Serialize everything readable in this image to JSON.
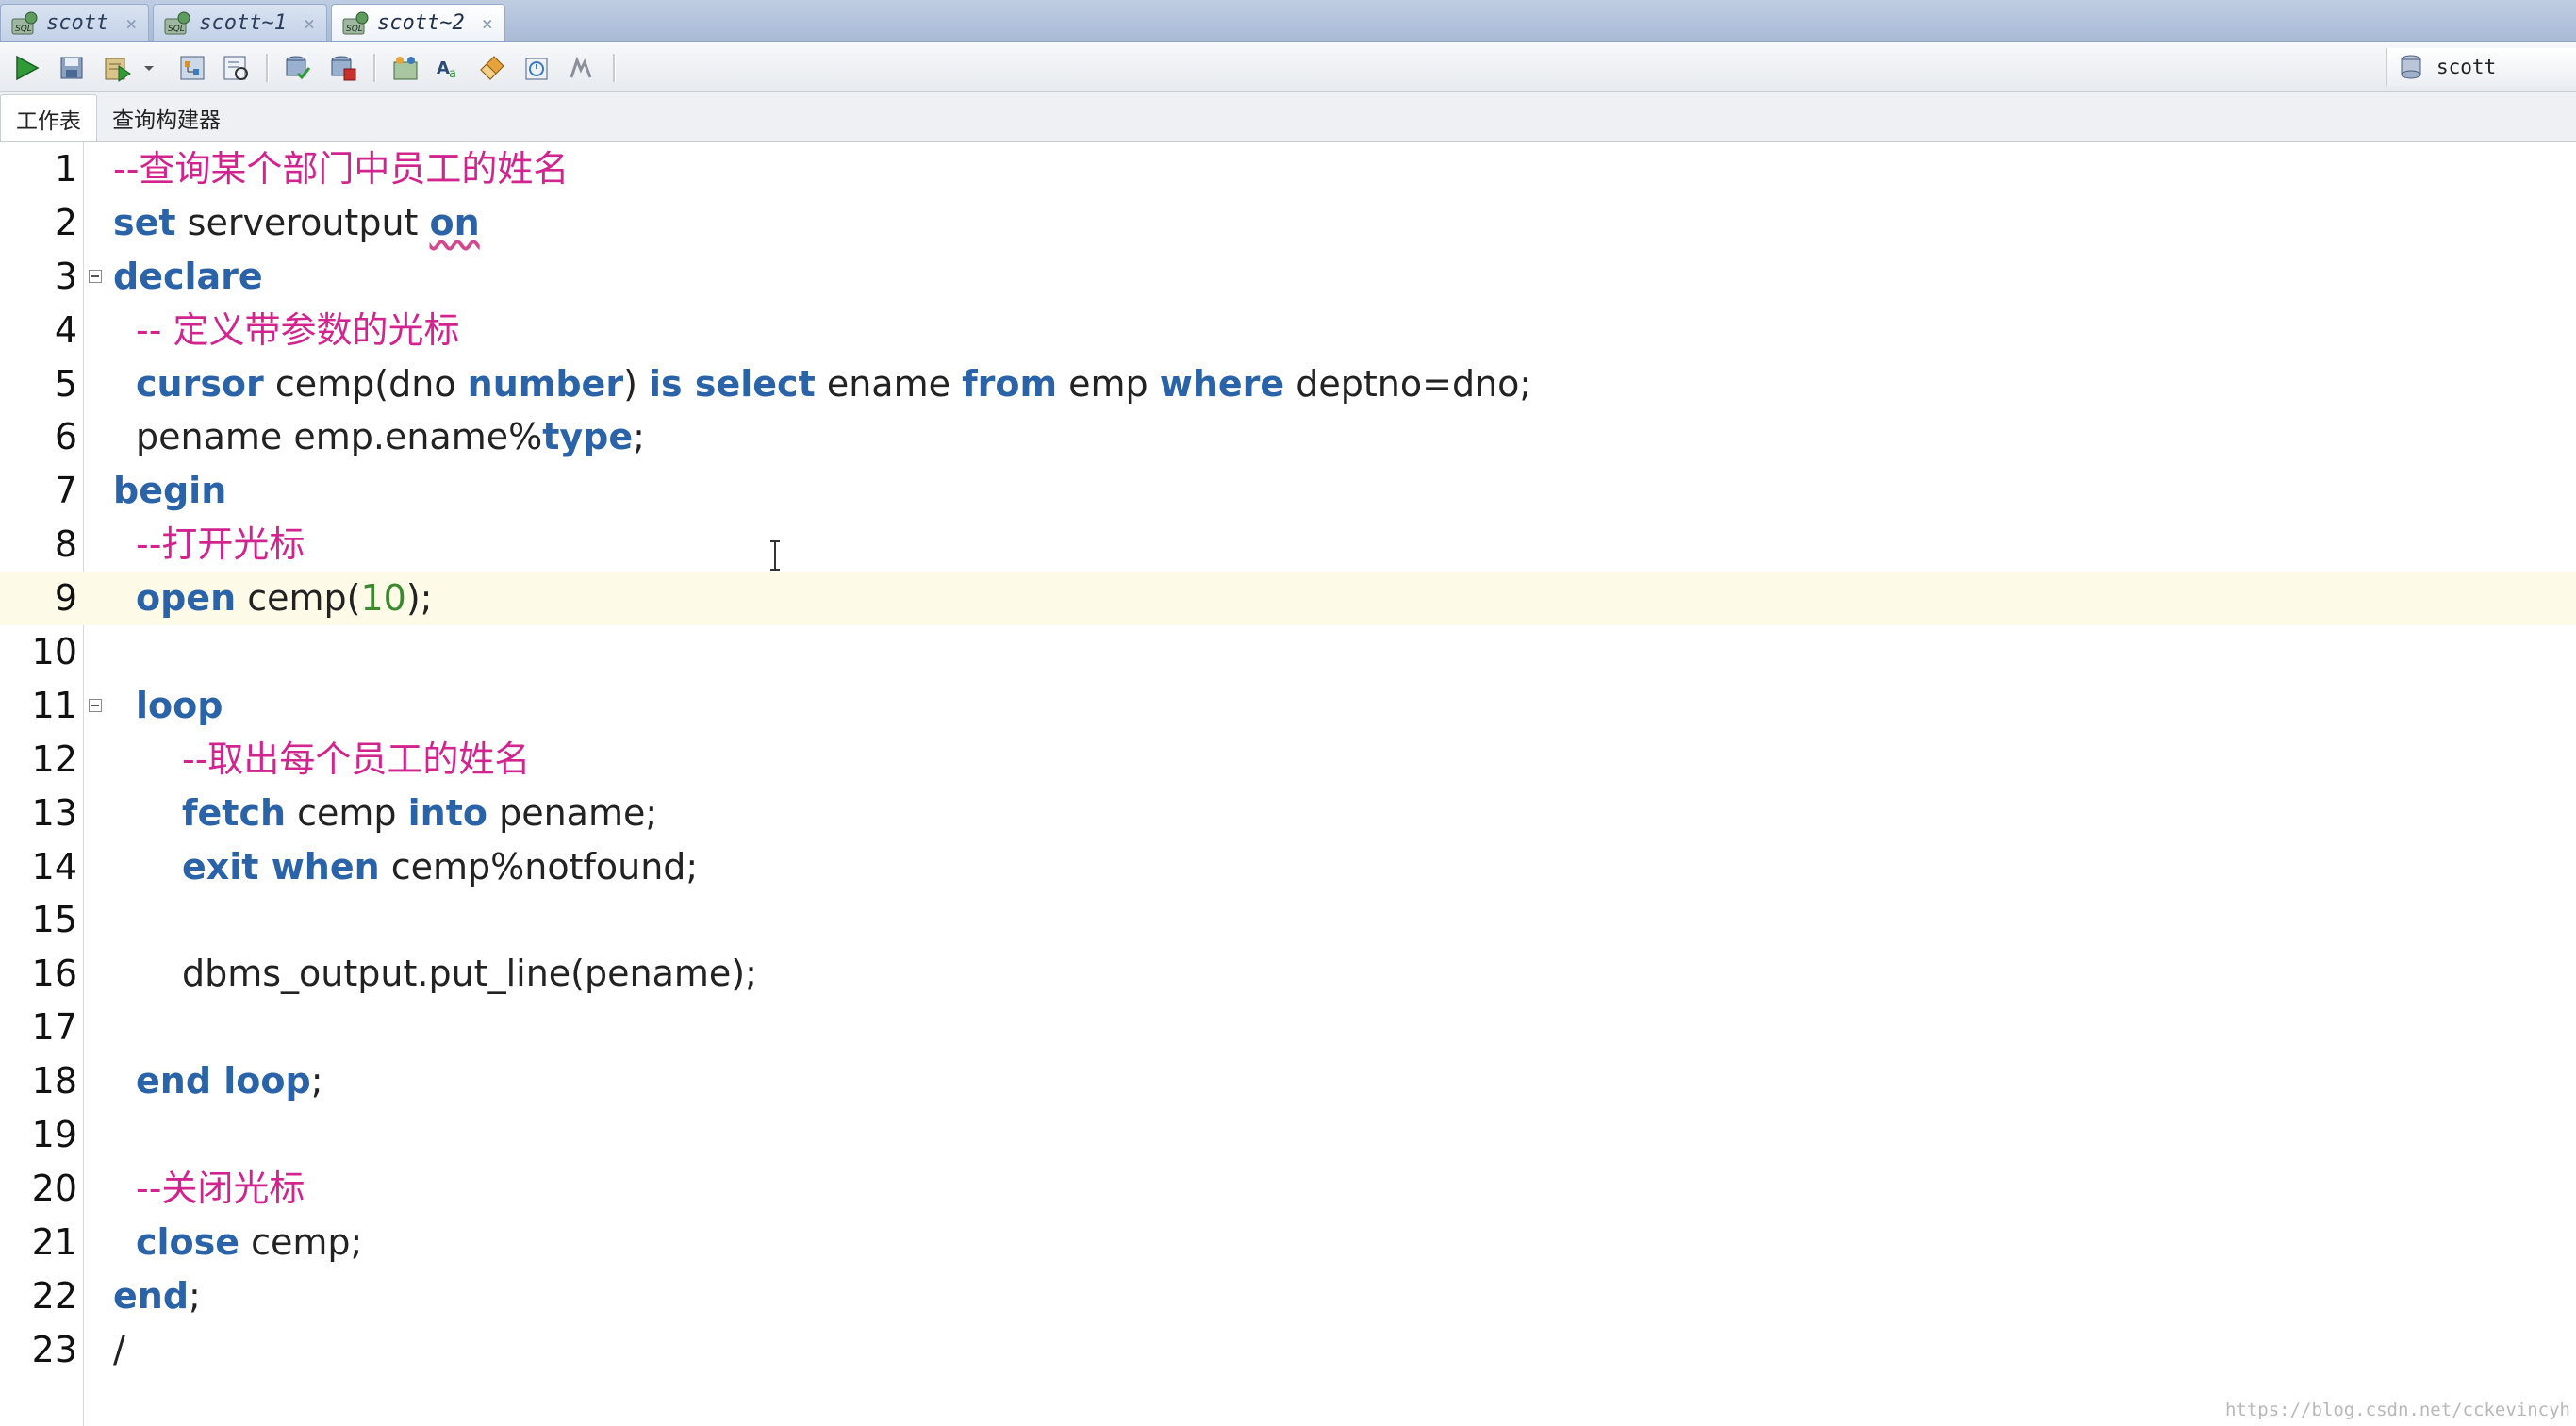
{
  "tabs": [
    {
      "label": "scott",
      "active": false
    },
    {
      "label": "scott~1",
      "active": false
    },
    {
      "label": "scott~2",
      "active": true
    }
  ],
  "toolbar": {
    "buttons": [
      "run-statement-icon",
      "save-icon",
      "run-script-icon",
      "dropdown-arrow-icon",
      "explain-plan-icon",
      "autotrace-icon",
      "commit-icon",
      "rollback-icon",
      "sql-tuning-icon",
      "format-text-icon",
      "clear-eraser-icon",
      "history-icon",
      "sql-monitor-icon"
    ],
    "connection_label": "scott"
  },
  "subtabs": [
    {
      "label": "工作表",
      "active": true
    },
    {
      "label": "查询构建器",
      "active": false
    }
  ],
  "editor": {
    "current_line": 9,
    "lines": [
      {
        "n": "1",
        "indent": 0,
        "fold": false,
        "tokens": [
          {
            "t": "--查询某个部门中员工的姓名",
            "c": "cm"
          }
        ]
      },
      {
        "n": "2",
        "indent": 0,
        "fold": false,
        "tokens": [
          {
            "t": "set",
            "c": "kw"
          },
          {
            "t": " serveroutput ",
            "c": "tx"
          },
          {
            "t": "on",
            "c": "kw sq"
          }
        ]
      },
      {
        "n": "3",
        "indent": 0,
        "fold": true,
        "tokens": [
          {
            "t": "declare",
            "c": "kw"
          }
        ]
      },
      {
        "n": "4",
        "indent": 1,
        "fold": false,
        "tokens": [
          {
            "t": "-- 定义带参数的光标",
            "c": "cm"
          }
        ]
      },
      {
        "n": "5",
        "indent": 1,
        "fold": false,
        "tokens": [
          {
            "t": "cursor",
            "c": "kw"
          },
          {
            "t": " cemp(dno ",
            "c": "tx"
          },
          {
            "t": "number",
            "c": "kw"
          },
          {
            "t": ") ",
            "c": "tx"
          },
          {
            "t": "is select",
            "c": "kw"
          },
          {
            "t": " ename ",
            "c": "tx"
          },
          {
            "t": "from",
            "c": "kw"
          },
          {
            "t": " emp ",
            "c": "tx"
          },
          {
            "t": "where",
            "c": "kw"
          },
          {
            "t": " deptno=dno;",
            "c": "tx"
          }
        ]
      },
      {
        "n": "6",
        "indent": 1,
        "fold": false,
        "tokens": [
          {
            "t": "pename emp.ename%",
            "c": "tx"
          },
          {
            "t": "type",
            "c": "kw"
          },
          {
            "t": ";",
            "c": "tx"
          }
        ]
      },
      {
        "n": "7",
        "indent": 0,
        "fold": false,
        "tokens": [
          {
            "t": "begin",
            "c": "kw"
          }
        ]
      },
      {
        "n": "8",
        "indent": 1,
        "fold": false,
        "tokens": [
          {
            "t": "--打开光标",
            "c": "cm"
          }
        ]
      },
      {
        "n": "9",
        "indent": 1,
        "fold": false,
        "tokens": [
          {
            "t": "open",
            "c": "kw"
          },
          {
            "t": " cemp(",
            "c": "tx"
          },
          {
            "t": "10",
            "c": "nm"
          },
          {
            "t": ");",
            "c": "tx"
          }
        ]
      },
      {
        "n": "10",
        "indent": 0,
        "fold": false,
        "tokens": []
      },
      {
        "n": "11",
        "indent": 1,
        "fold": true,
        "tokens": [
          {
            "t": "loop",
            "c": "kw"
          }
        ]
      },
      {
        "n": "12",
        "indent": 2,
        "fold": false,
        "tokens": [
          {
            "t": "--取出每个员工的姓名",
            "c": "cm"
          }
        ]
      },
      {
        "n": "13",
        "indent": 2,
        "fold": false,
        "tokens": [
          {
            "t": "fetch",
            "c": "kw"
          },
          {
            "t": " cemp ",
            "c": "tx"
          },
          {
            "t": "into",
            "c": "kw"
          },
          {
            "t": " pename;",
            "c": "tx"
          }
        ]
      },
      {
        "n": "14",
        "indent": 2,
        "fold": false,
        "tokens": [
          {
            "t": "exit when",
            "c": "kw"
          },
          {
            "t": " cemp%notfound;",
            "c": "tx"
          }
        ]
      },
      {
        "n": "15",
        "indent": 0,
        "fold": false,
        "tokens": []
      },
      {
        "n": "16",
        "indent": 2,
        "fold": false,
        "tokens": [
          {
            "t": "dbms_output.put_line(pename);",
            "c": "tx"
          }
        ]
      },
      {
        "n": "17",
        "indent": 0,
        "fold": false,
        "tokens": []
      },
      {
        "n": "18",
        "indent": 1,
        "fold": false,
        "tokens": [
          {
            "t": "end loop",
            "c": "kw"
          },
          {
            "t": ";",
            "c": "tx"
          }
        ]
      },
      {
        "n": "19",
        "indent": 0,
        "fold": false,
        "tokens": []
      },
      {
        "n": "20",
        "indent": 1,
        "fold": false,
        "tokens": [
          {
            "t": "--关闭光标",
            "c": "cm"
          }
        ]
      },
      {
        "n": "21",
        "indent": 1,
        "fold": false,
        "tokens": [
          {
            "t": "close",
            "c": "kw"
          },
          {
            "t": " cemp;",
            "c": "tx"
          }
        ]
      },
      {
        "n": "22",
        "indent": 0,
        "fold": false,
        "tokens": [
          {
            "t": "end",
            "c": "kw"
          },
          {
            "t": ";",
            "c": "tx"
          }
        ]
      },
      {
        "n": "23",
        "indent": 0,
        "fold": false,
        "tokens": [
          {
            "t": "/",
            "c": "tx"
          }
        ]
      }
    ]
  },
  "watermark": "https://blog.csdn.net/cckevincyh",
  "colors": {
    "keyword": "#2b63a8",
    "comment": "#d2248e",
    "number": "#3b8a2e",
    "current_line": "#fdfbe8"
  }
}
